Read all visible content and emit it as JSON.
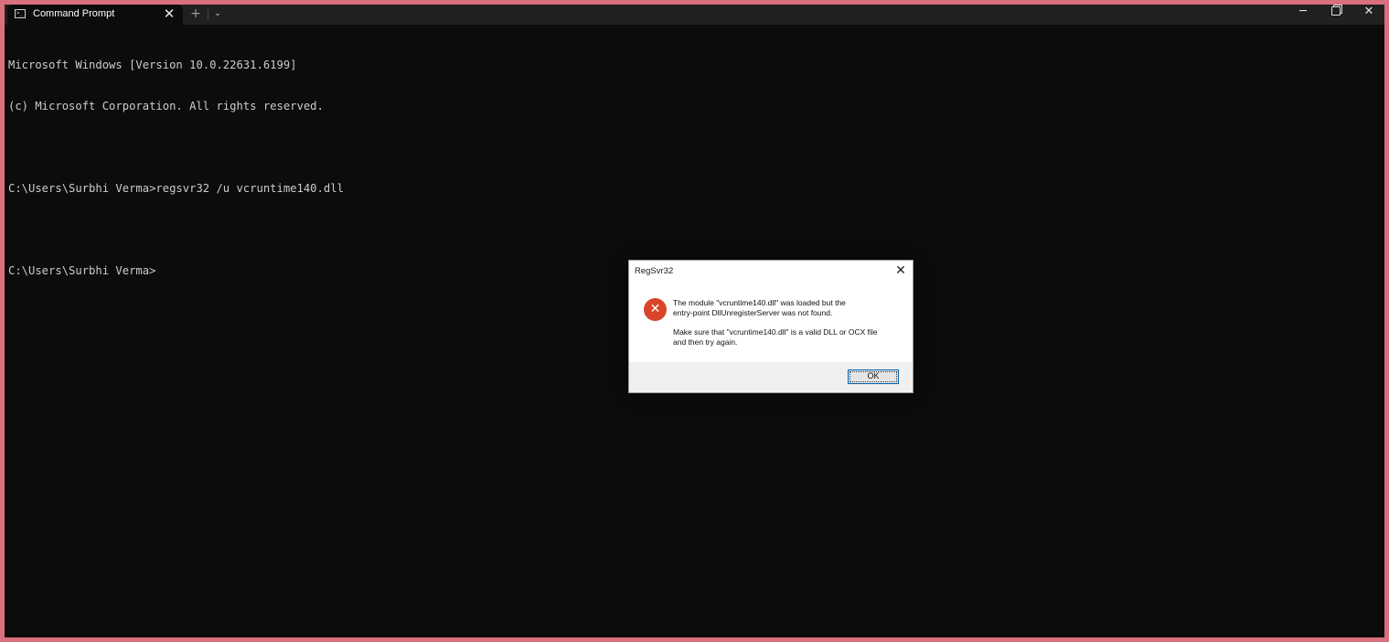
{
  "window": {
    "tab_title": "Command Prompt",
    "tab_close": "✕",
    "new_tab": "+",
    "dropdown": "⌄",
    "minimize": "─",
    "close": "✕"
  },
  "console": {
    "lines": [
      "Microsoft Windows [Version 10.0.22631.6199]",
      "(c) Microsoft Corporation. All rights reserved.",
      "",
      "C:\\Users\\Surbhi Verma>regsvr32 /u vcruntime140.dll",
      "",
      "C:\\Users\\Surbhi Verma>"
    ]
  },
  "dialog": {
    "title": "RegSvr32",
    "close": "✕",
    "icon": "error-icon",
    "icon_glyph": "✕",
    "message_line1": "The module \"vcruntime140.dll\" was loaded but the",
    "message_line2": "entry-point DllUnregisterServer was not found.",
    "message_line3": "Make sure that \"vcruntime140.dll\" is a valid DLL or OCX file",
    "message_line4": "and then try again.",
    "ok_label": "OK"
  },
  "colors": {
    "border_accent": "#d9707e",
    "console_bg": "#0c0c0c",
    "error_red": "#d9452a",
    "focus_blue": "#0063b1"
  }
}
